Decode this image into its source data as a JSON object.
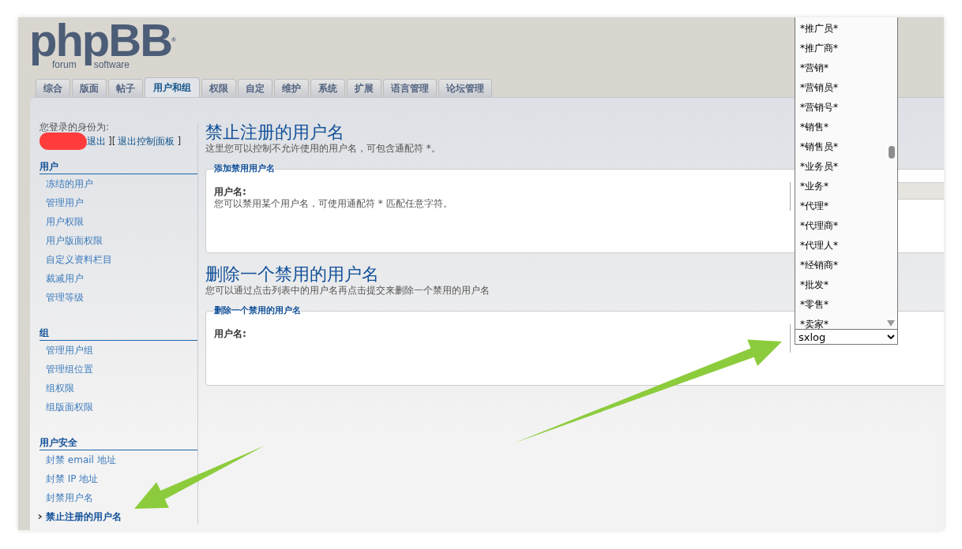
{
  "logo": {
    "name": "phpBB",
    "word_1": "forum",
    "word_2": "software",
    "mark": "®"
  },
  "tabs": [
    {
      "label": "综合",
      "selected": false
    },
    {
      "label": "版面",
      "selected": false
    },
    {
      "label": "帖子",
      "selected": false
    },
    {
      "label": "用户和组",
      "selected": true
    },
    {
      "label": "权限",
      "selected": false
    },
    {
      "label": "自定",
      "selected": false
    },
    {
      "label": "维护",
      "selected": false
    },
    {
      "label": "系统",
      "selected": false
    },
    {
      "label": "扩展",
      "selected": false
    },
    {
      "label": "语言管理",
      "selected": false
    },
    {
      "label": "论坛管理",
      "selected": false
    }
  ],
  "sidebar": {
    "login_label": "您登录的身份为:",
    "logout_link": "退出",
    "separator": "][",
    "acp_link": "退出控制面板",
    "close_bracket": "]",
    "sections": [
      {
        "title": "用户",
        "items": [
          {
            "label": "冻结的用户",
            "selected": false
          },
          {
            "label": "管理用户",
            "selected": false
          },
          {
            "label": "用户权限",
            "selected": false
          },
          {
            "label": "用户版面权限",
            "selected": false
          },
          {
            "label": "自定义资料栏目",
            "selected": false
          },
          {
            "label": "裁减用户",
            "selected": false
          },
          {
            "label": "管理等级",
            "selected": false
          }
        ]
      },
      {
        "title": "组",
        "items": [
          {
            "label": "管理用户组",
            "selected": false
          },
          {
            "label": "管理组位置",
            "selected": false
          },
          {
            "label": "组权限",
            "selected": false
          },
          {
            "label": "组版面权限",
            "selected": false
          }
        ]
      },
      {
        "title": "用户安全",
        "items": [
          {
            "label": "封禁 email 地址",
            "selected": false
          },
          {
            "label": "封禁 IP 地址",
            "selected": false
          },
          {
            "label": "封禁用户名",
            "selected": false
          },
          {
            "label": "禁止注册的用户名",
            "selected": true
          }
        ]
      }
    ]
  },
  "main": [
    {
      "title": "禁止注册的用户名",
      "description": "这里您可以控制不允许使用的用户名，可包含通配符 *。",
      "legend": "添加禁用用户名",
      "label": "用户名:",
      "explain": "您可以禁用某个用户名，可使用通配符 * 匹配任意字符。",
      "kind": "input"
    },
    {
      "title": "删除一个禁用的用户名",
      "description": "您可以通过点击列表中的用户名再点击提交来删除一个禁用的用户名",
      "legend": "删除一个禁用的用户名",
      "label": "用户名:",
      "kind": "select"
    }
  ],
  "dropdown": {
    "value": "sxlog",
    "options": [
      "*推广员*",
      "*推广商*",
      "*营销*",
      "*营销员*",
      "*营销号*",
      "*销售*",
      "*销售员*",
      "*业务员*",
      "*业务*",
      "*代理*",
      "*代理商*",
      "*代理人*",
      "*经销商*",
      "*批发*",
      "*零售*",
      "*卖家*"
    ]
  }
}
